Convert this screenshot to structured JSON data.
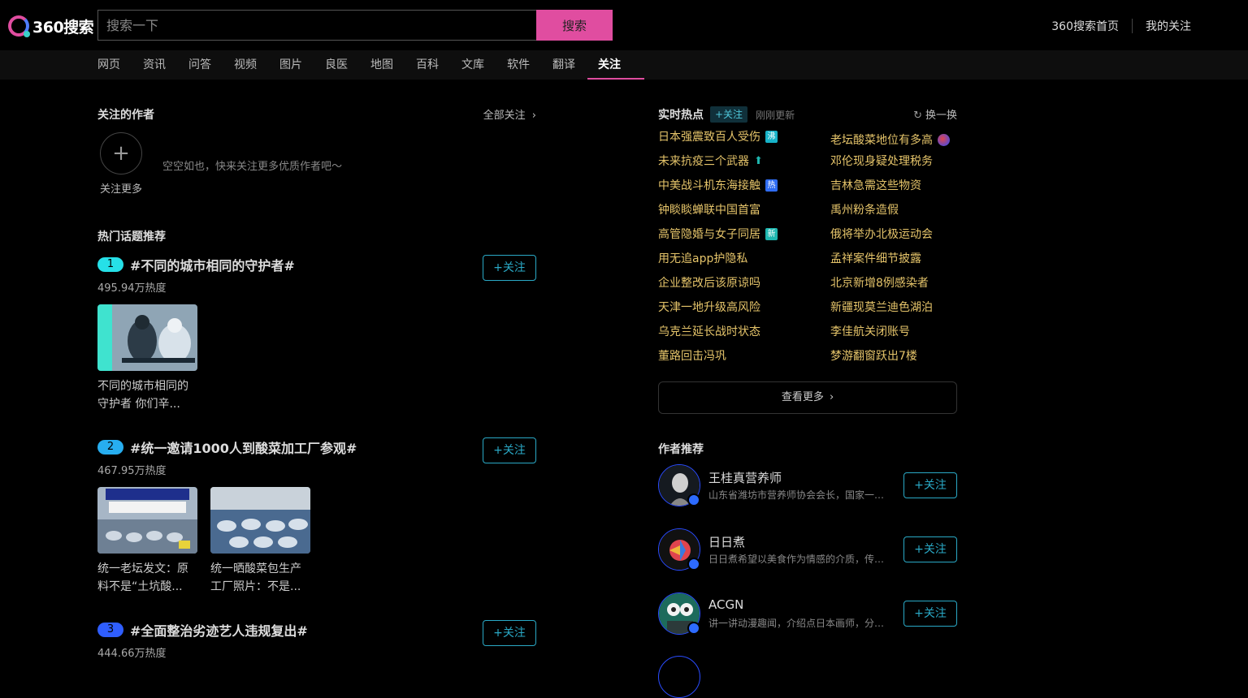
{
  "header": {
    "logo_text": "360搜索",
    "search_placeholder": "搜索一下",
    "search_button": "搜索",
    "links": [
      "360搜索首页",
      "我的关注"
    ]
  },
  "nav": {
    "items": [
      "网页",
      "资讯",
      "问答",
      "视频",
      "图片",
      "良医",
      "地图",
      "百科",
      "文库",
      "软件",
      "翻译",
      "关注"
    ],
    "active": "关注"
  },
  "followed_authors": {
    "title": "关注的作者",
    "all_link": "全部关注",
    "add_label": "关注更多",
    "empty_tip": "空空如也，快来关注更多优质作者吧～"
  },
  "hot_topics": {
    "title": "热门话题推荐",
    "follow_label": "+关注",
    "items": [
      {
        "rank": "1",
        "rank_color": "#26e0e8",
        "title": "#不同的城市相同的守护者#",
        "heat": "495.94万热度",
        "thumbs": [
          {
            "caption": "不同的城市相同的守护者 你们辛..."
          }
        ]
      },
      {
        "rank": "2",
        "rank_color": "#27aef0",
        "title": "#统一邀请1000人到酸菜加工厂参观#",
        "heat": "467.95万热度",
        "thumbs": [
          {
            "caption": "统一老坛发文：原料不是“土坑酸..."
          },
          {
            "caption": "统一晒酸菜包生产工厂照片：不是..."
          }
        ]
      },
      {
        "rank": "3",
        "rank_color": "#2f5eff",
        "title": "#全面整治劣迹艺人违规复出#",
        "heat": "444.66万热度",
        "thumbs": []
      }
    ]
  },
  "realtime_hot": {
    "title": "实时热点",
    "tag": "+关注",
    "updated": "刚刚更新",
    "refresh": "换一换",
    "items": [
      {
        "text": "日本强震致百人受伤",
        "badge": "沸",
        "badge_color": "#17b3c9"
      },
      {
        "text": "老坛酸菜地位有多高",
        "badge": "",
        "badge_color": ""
      },
      {
        "text": "未来抗疫三个武器",
        "badge": "",
        "badge_color": ""
      },
      {
        "text": "邓伦现身疑处理税务",
        "badge": "",
        "badge_color": ""
      },
      {
        "text": "中美战斗机东海接触",
        "badge": "热",
        "badge_color": "#2f6cf2"
      },
      {
        "text": "吉林急需这些物资",
        "badge": "",
        "badge_color": ""
      },
      {
        "text": "钟睒睒蝉联中国首富",
        "badge": "",
        "badge_color": ""
      },
      {
        "text": "禹州粉条造假",
        "badge": "",
        "badge_color": ""
      },
      {
        "text": "高管隐婚与女子同居",
        "badge": "新",
        "badge_color": "#1fb7b0"
      },
      {
        "text": "俄将举办北极运动会",
        "badge": "",
        "badge_color": ""
      },
      {
        "text": "用无追app护隐私",
        "badge": "",
        "badge_color": ""
      },
      {
        "text": "孟祥案件细节披露",
        "badge": "",
        "badge_color": ""
      },
      {
        "text": "企业整改后该原谅吗",
        "badge": "",
        "badge_color": ""
      },
      {
        "text": "北京新增8例感染者",
        "badge": "",
        "badge_color": ""
      },
      {
        "text": "天津一地升级高风险",
        "badge": "",
        "badge_color": ""
      },
      {
        "text": "新疆现莫兰迪色湖泊",
        "badge": "",
        "badge_color": ""
      },
      {
        "text": "乌克兰延长战时状态",
        "badge": "",
        "badge_color": ""
      },
      {
        "text": "李佳航关闭账号",
        "badge": "",
        "badge_color": ""
      },
      {
        "text": "董路回击冯巩",
        "badge": "",
        "badge_color": ""
      },
      {
        "text": "梦游翻窗跃出7楼",
        "badge": "",
        "badge_color": ""
      }
    ],
    "more": "查看更多"
  },
  "author_recommend": {
    "title": "作者推荐",
    "follow_label": "+关注",
    "items": [
      {
        "name": "王桂真营养师",
        "desc": "山东省潍坊市营养师协会会长，国家一级营养师"
      },
      {
        "name": "日日煮",
        "desc": "日日煮希望以美食作为情感的介质，传递美好生活"
      },
      {
        "name": "ACGN",
        "desc": "讲一讲动漫趣闻，介绍点日本画师，分享动漫资讯"
      }
    ]
  }
}
